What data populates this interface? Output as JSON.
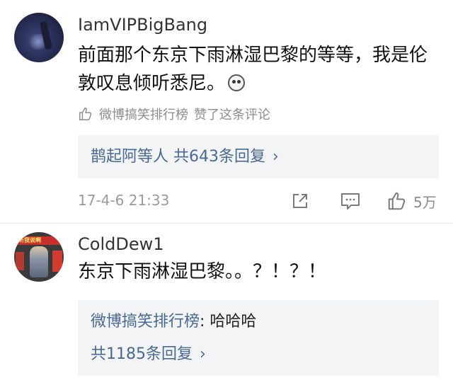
{
  "comments": [
    {
      "username": "IamVIPBigBang",
      "text": "前面那个东京下雨淋湿巴黎的等等，我是伦敦叹息倾听悉尼。",
      "liked_by": "微博搞笑排行榜",
      "liked_suffix": "赞了这条评论",
      "replies_summary": "鹊起阿等人  共643条回复",
      "timestamp": "17-4-6 21:33",
      "like_count": "5万"
    },
    {
      "username": "ColdDew1",
      "avatar_banner": "听我说啊",
      "text": "东京下雨淋湿巴黎。。？！？！",
      "reply_author": "微博搞笑排行榜",
      "reply_text": ": 哈哈哈",
      "replies_total": "共1185条回复"
    }
  ],
  "icons": {
    "chevron": "chevron-right-icon",
    "thumb": "thumbs-up-icon",
    "share": "share-icon",
    "comment": "comment-icon"
  },
  "colors": {
    "link": "#4a6894",
    "meta": "#9b9b9b",
    "reply_bg": "#f3f4f6"
  }
}
